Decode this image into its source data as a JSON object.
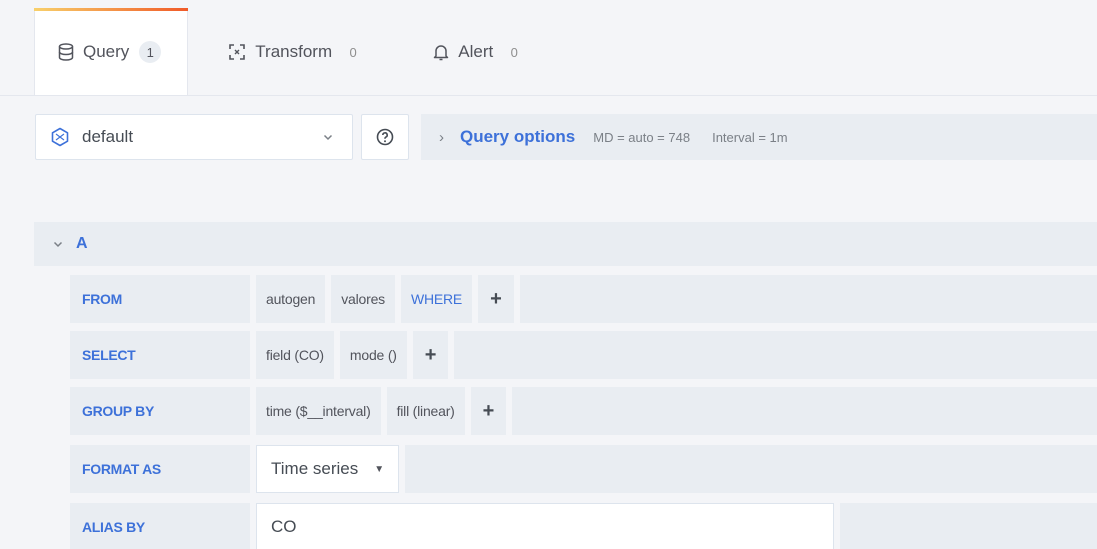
{
  "tabs": [
    {
      "label": "Query",
      "count": "1",
      "icon": "database-icon"
    },
    {
      "label": "Transform",
      "count": "0",
      "icon": "transform-icon"
    },
    {
      "label": "Alert",
      "count": "0",
      "icon": "bell-icon"
    }
  ],
  "datasource": {
    "label": "default",
    "icon": "influxdb-icon"
  },
  "query_options": {
    "title": "Query options",
    "md": "MD = auto = 748",
    "interval": "Interval = 1m"
  },
  "query": {
    "ref_id": "A",
    "from": {
      "key": "FROM",
      "policy": "autogen",
      "measurement": "valores",
      "where": "WHERE",
      "add": "+"
    },
    "select": {
      "key": "SELECT",
      "field": "field (CO)",
      "agg": "mode ()",
      "add": "+"
    },
    "group_by": {
      "key": "GROUP BY",
      "time": "time ($__interval)",
      "fill": "fill (linear)",
      "add": "+"
    },
    "format_as": {
      "key": "FORMAT AS",
      "value": "Time series"
    },
    "alias_by": {
      "key": "ALIAS BY",
      "value": "CO"
    }
  },
  "colors": {
    "accent": "#3d71d9",
    "panel": "#e9edf2",
    "background": "#f4f5f8"
  }
}
